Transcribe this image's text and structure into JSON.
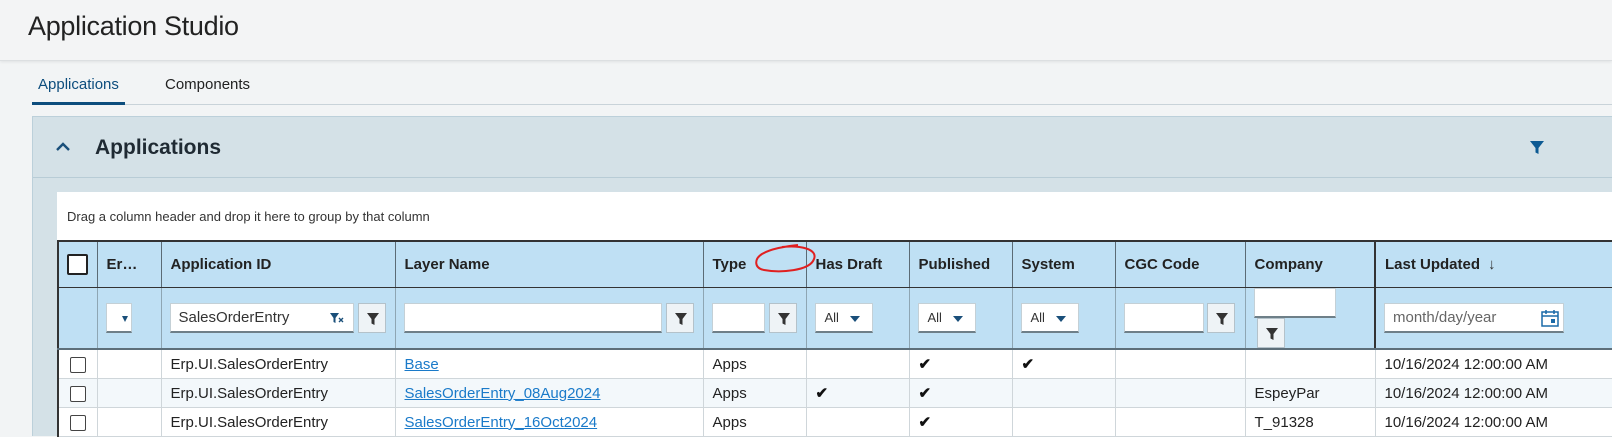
{
  "app": {
    "title": "Application Studio"
  },
  "tabs": [
    {
      "label": "Applications",
      "active": true
    },
    {
      "label": "Components",
      "active": false
    }
  ],
  "panel": {
    "title": "Applications",
    "group_hint": "Drag a column header and drop it here to group by that column"
  },
  "columns": {
    "er": "Er…",
    "app_id": "Application ID",
    "layer": "Layer Name",
    "type": "Type",
    "has_draft": "Has Draft",
    "published": "Published",
    "system": "System",
    "cgc": "CGC Code",
    "company": "Company",
    "last_updated": "Last Updated",
    "sort_glyph": "↓"
  },
  "filters": {
    "app_id_value": "SalesOrderEntry",
    "has_draft": "All",
    "published": "All",
    "system": "All",
    "date_placeholder": "month/day/year"
  },
  "rows": [
    {
      "app_id": "Erp.UI.SalesOrderEntry",
      "layer": "Base",
      "type": "Apps",
      "has_draft": "",
      "published": "✔",
      "system": "✔",
      "cgc": "",
      "company": "",
      "last_updated": "10/16/2024 12:00:00 AM"
    },
    {
      "app_id": "Erp.UI.SalesOrderEntry",
      "layer": "SalesOrderEntry_08Aug2024",
      "type": "Apps",
      "has_draft": "✔",
      "published": "✔",
      "system": "",
      "cgc": "",
      "company": "EspeyPar",
      "last_updated": "10/16/2024 12:00:00 AM"
    },
    {
      "app_id": "Erp.UI.SalesOrderEntry",
      "layer": "SalesOrderEntry_16Oct2024",
      "type": "Apps",
      "has_draft": "",
      "published": "✔",
      "system": "",
      "cgc": "",
      "company": "T_91328",
      "last_updated": "10/16/2024 12:00:00 AM"
    }
  ],
  "colors": {
    "accent": "#0d4d7d",
    "header_bg": "#bfe0f4",
    "panel_bg": "#d4e1e7",
    "link": "#1a7ac9",
    "annotation": "#e02020"
  }
}
